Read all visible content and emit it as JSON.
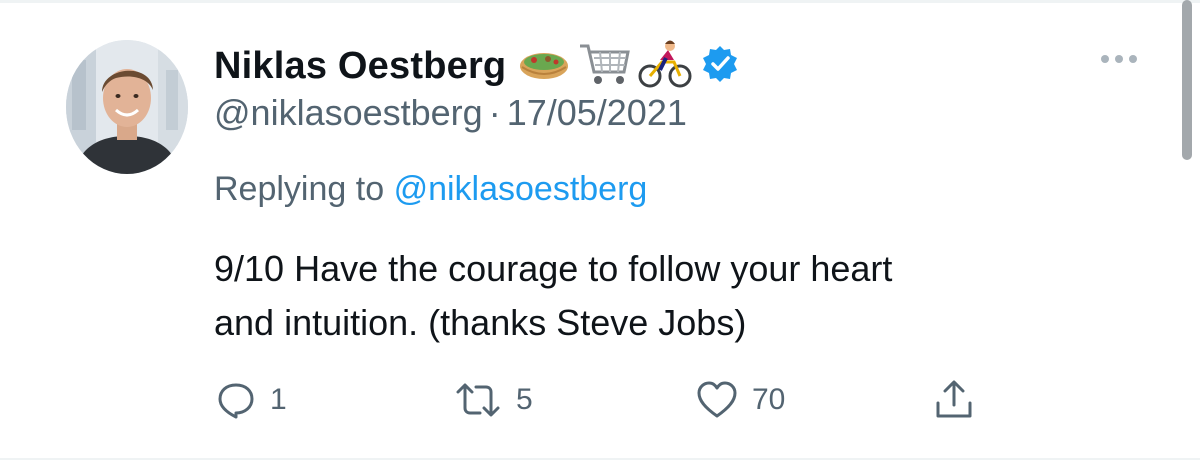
{
  "author": {
    "display_name": "Niklas Oestberg",
    "name_emojis": [
      "burrito-emoji",
      "shopping-cart-emoji",
      "cyclist-emoji"
    ],
    "handle": "@niklasoestberg",
    "separator": "·",
    "date": "17/05/2021",
    "verified": true
  },
  "reply": {
    "prefix": "Replying to",
    "to": "@niklasoestberg"
  },
  "tweet": {
    "lines": [
      "9/10 Have the courage to follow your heart",
      "and intuition. (thanks Steve Jobs)"
    ]
  },
  "actions": {
    "reply_count": "1",
    "retweet_count": "5",
    "like_count": "70"
  },
  "colors": {
    "text": "#0f1419",
    "secondary": "#536471",
    "accent": "#1d9bf0",
    "divider": "#eff3f4"
  }
}
